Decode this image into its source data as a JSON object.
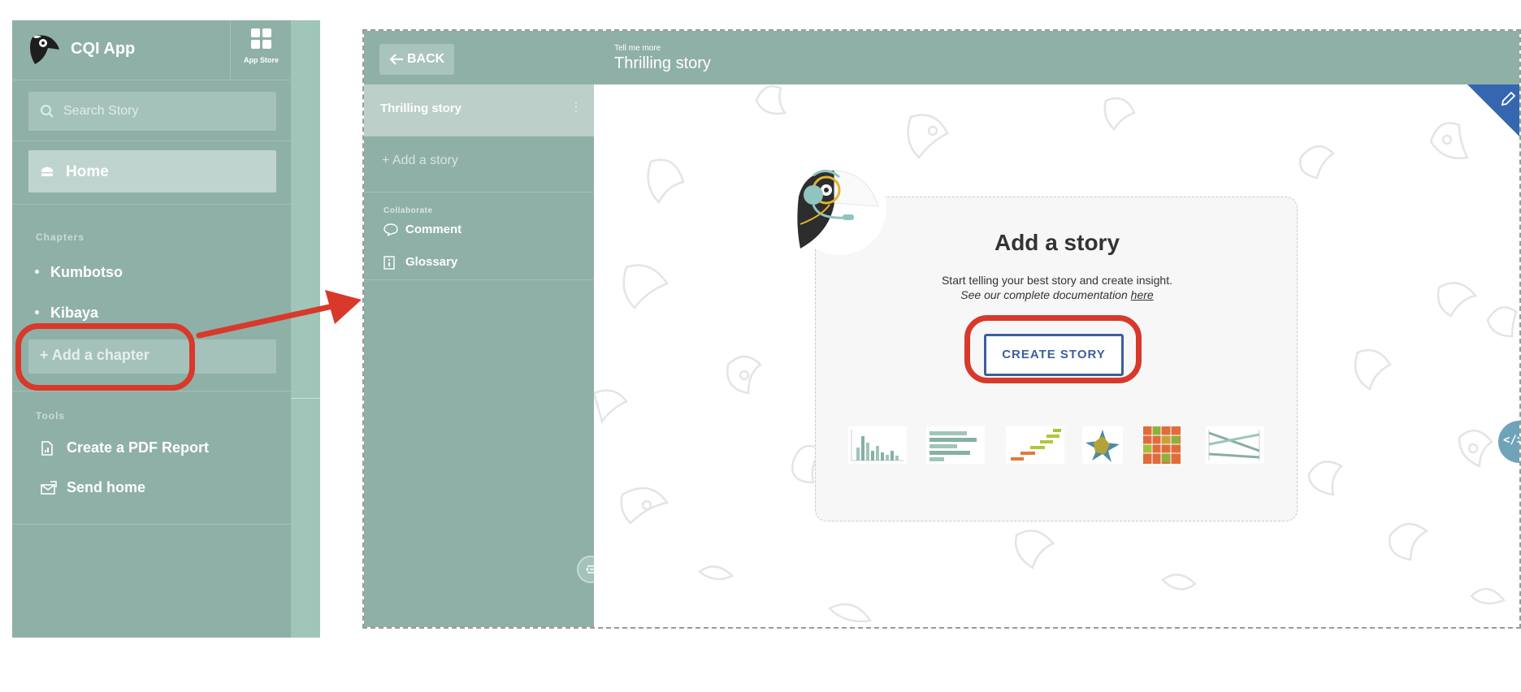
{
  "left": {
    "app_title": "CQI App",
    "app_store_label": "App Store",
    "search_placeholder": "Search Story",
    "home_label": "Home",
    "chapters_heading": "Chapters",
    "chapters": [
      {
        "label": "Kumbotso"
      },
      {
        "label": "Kibaya"
      }
    ],
    "add_chapter_label": "+ Add a chapter",
    "tools_heading": "Tools",
    "tools": [
      {
        "label": "Create a PDF Report",
        "icon": "pdf-report-icon"
      },
      {
        "label": "Send home",
        "icon": "send-home-icon"
      }
    ]
  },
  "story": {
    "back_label": "BACK",
    "header_subtitle": "Tell me more",
    "header_title": "Thrilling story",
    "selected_story": "Thrilling story",
    "add_story_label": "+ Add a story",
    "collaborate_heading": "Collaborate",
    "collab_items": [
      {
        "label": "Comment",
        "icon": "comment-icon"
      },
      {
        "label": "Glossary",
        "icon": "glossary-icon"
      }
    ],
    "card": {
      "title": "Add a story",
      "description": "Start telling your best story and create insight.",
      "doc_prefix": "See our complete documentation ",
      "doc_link": "here",
      "create_button": "CREATE STORY"
    },
    "code_tab": "</>"
  },
  "colors": {
    "sidebar": "#8fb0a7",
    "accent_blue": "#3c5f9c",
    "callout_red": "#d8392a"
  }
}
